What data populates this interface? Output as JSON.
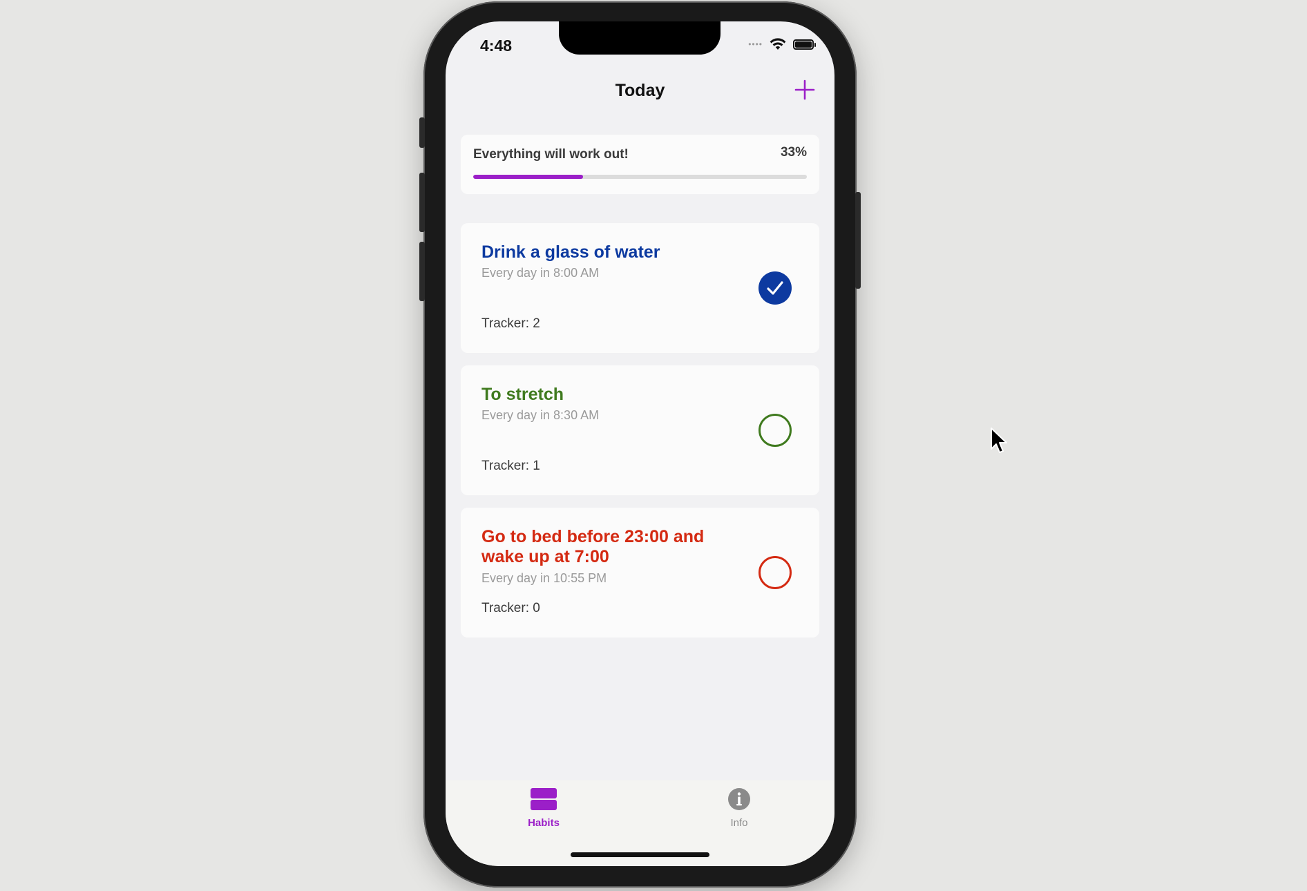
{
  "status_bar": {
    "time": "4:48"
  },
  "nav": {
    "title": "Today",
    "add_icon": "plus-icon"
  },
  "progress": {
    "label": "Everything will work out!",
    "percent_text": "33%",
    "fraction": 0.33,
    "color": "#9b1fc8"
  },
  "habits": [
    {
      "title": "Drink a glass of water",
      "schedule": "Every day in 8:00 AM",
      "tracker": "Tracker: 2",
      "done": true,
      "color": "#0d3aa0"
    },
    {
      "title": "To stretch",
      "schedule": "Every day in 8:30 AM",
      "tracker": "Tracker: 1",
      "done": false,
      "color": "#3f7a1e"
    },
    {
      "title": "Go to bed before 23:00 and wake up at 7:00",
      "schedule": "Every day in 10:55 PM",
      "tracker": "Tracker: 0",
      "done": false,
      "color": "#d42a12"
    }
  ],
  "tabbar": {
    "habits_label": "Habits",
    "info_label": "Info",
    "active_color": "#9b1fc8",
    "inactive_color": "#8a8a8a"
  }
}
